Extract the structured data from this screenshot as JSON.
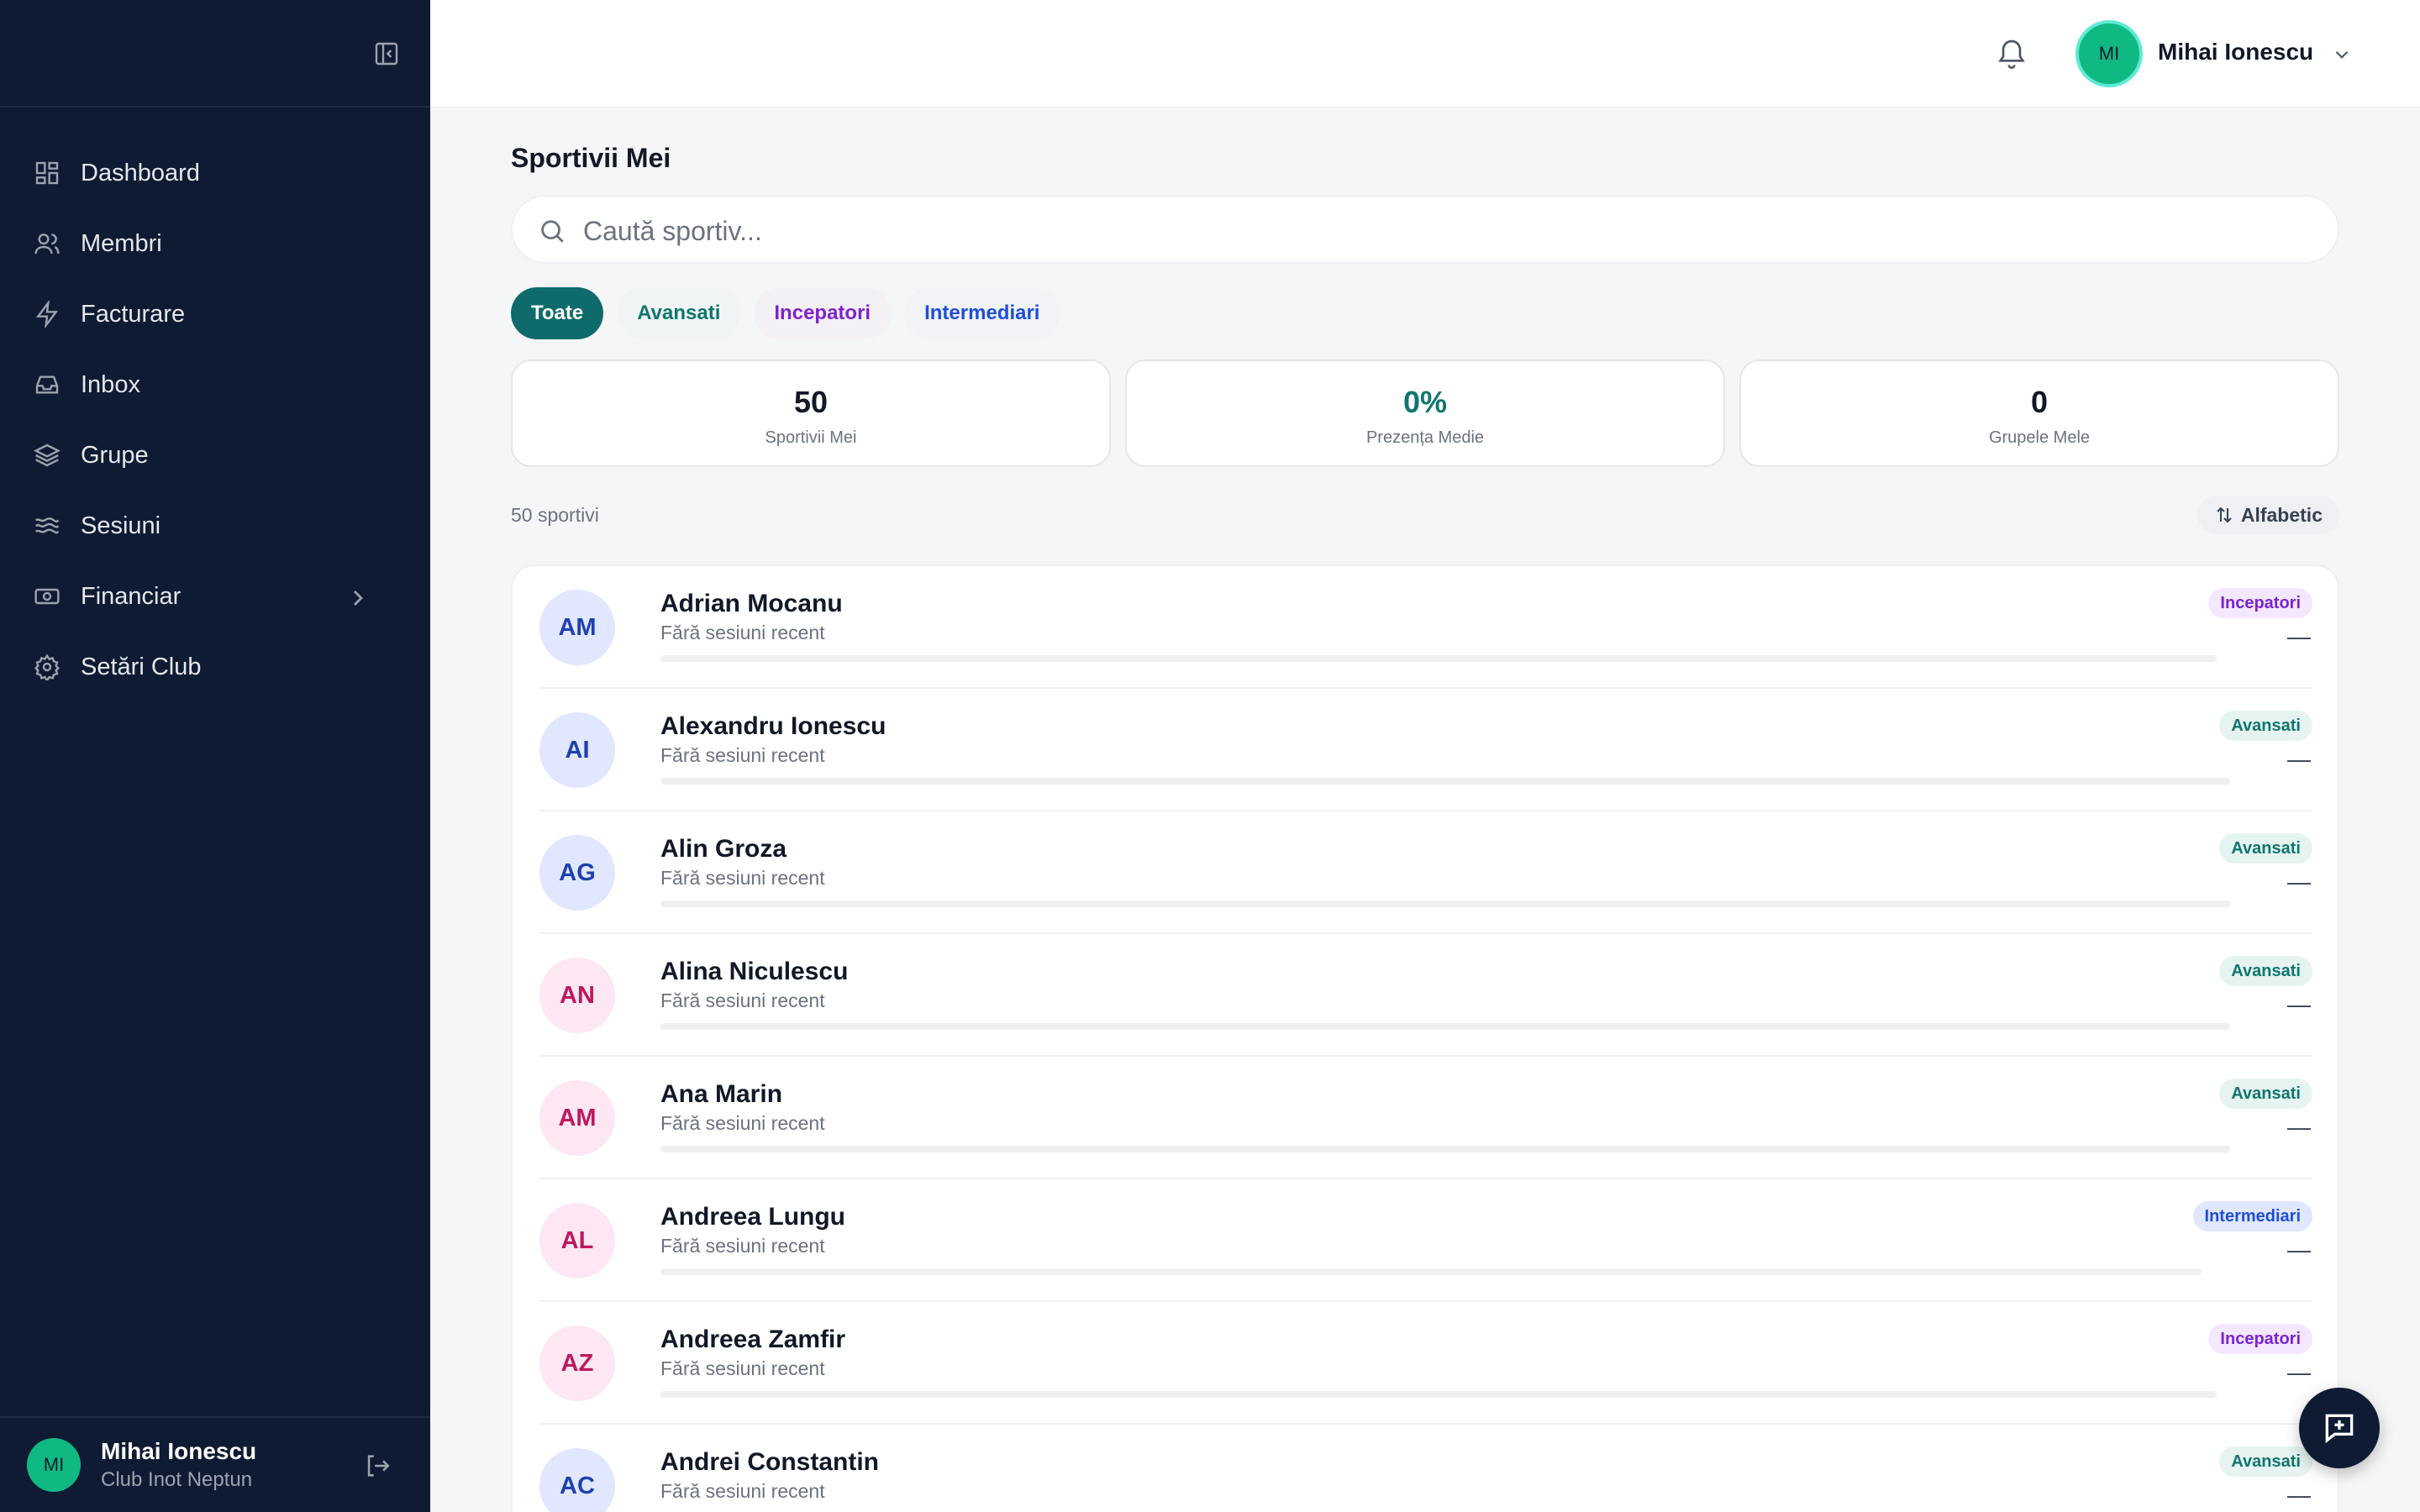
{
  "sidebar": {
    "items": [
      {
        "label": "Dashboard",
        "icon": "dashboard-icon"
      },
      {
        "label": "Membri",
        "icon": "users-icon"
      },
      {
        "label": "Facturare",
        "icon": "lightning-icon"
      },
      {
        "label": "Inbox",
        "icon": "inbox-icon"
      },
      {
        "label": "Grupe",
        "icon": "layers-icon"
      },
      {
        "label": "Sesiuni",
        "icon": "waves-icon"
      },
      {
        "label": "Financiar",
        "icon": "money-icon"
      },
      {
        "label": "Setări Club",
        "icon": "gear-icon"
      }
    ],
    "user": {
      "initials": "MI",
      "name": "Mihai Ionescu",
      "club": "Club Inot Neptun"
    }
  },
  "header": {
    "initials": "MI",
    "name": "Mihai Ionescu"
  },
  "main": {
    "title": "Sportivii Mei",
    "search_placeholder": "Caută sportiv...",
    "filters": [
      "Toate",
      "Avansati",
      "Incepatori",
      "Intermediari"
    ],
    "stats": [
      {
        "value": "50",
        "label": "Sportivii Mei"
      },
      {
        "value": "0%",
        "label": "Prezența Medie"
      },
      {
        "value": "0",
        "label": "Grupele Mele"
      }
    ],
    "count_label": "50 sportivi",
    "sort_label": "Alfabetic",
    "athletes": [
      {
        "initials": "AM",
        "name": "Adrian Mocanu",
        "sub": "Fără sesiuni recent",
        "level": "Incepatori",
        "value": "—"
      },
      {
        "initials": "AI",
        "name": "Alexandru Ionescu",
        "sub": "Fără sesiuni recent",
        "level": "Avansati",
        "value": "—"
      },
      {
        "initials": "AG",
        "name": "Alin Groza",
        "sub": "Fără sesiuni recent",
        "level": "Avansati",
        "value": "—"
      },
      {
        "initials": "AN",
        "name": "Alina Niculescu",
        "sub": "Fără sesiuni recent",
        "level": "Avansati",
        "value": "—"
      },
      {
        "initials": "AM",
        "name": "Ana Marin",
        "sub": "Fără sesiuni recent",
        "level": "Avansati",
        "value": "—"
      },
      {
        "initials": "AL",
        "name": "Andreea Lungu",
        "sub": "Fără sesiuni recent",
        "level": "Intermediari",
        "value": "—"
      },
      {
        "initials": "AZ",
        "name": "Andreea Zamfir",
        "sub": "Fără sesiuni recent",
        "level": "Incepatori",
        "value": "—"
      },
      {
        "initials": "AC",
        "name": "Andrei Constantin",
        "sub": "Fără sesiuni recent",
        "level": "Avansati",
        "value": "—"
      }
    ]
  },
  "colors": {
    "sidebar_bg": "#0f1b33",
    "accent": "#0f6b6b",
    "avatar_green": "#10b981"
  }
}
